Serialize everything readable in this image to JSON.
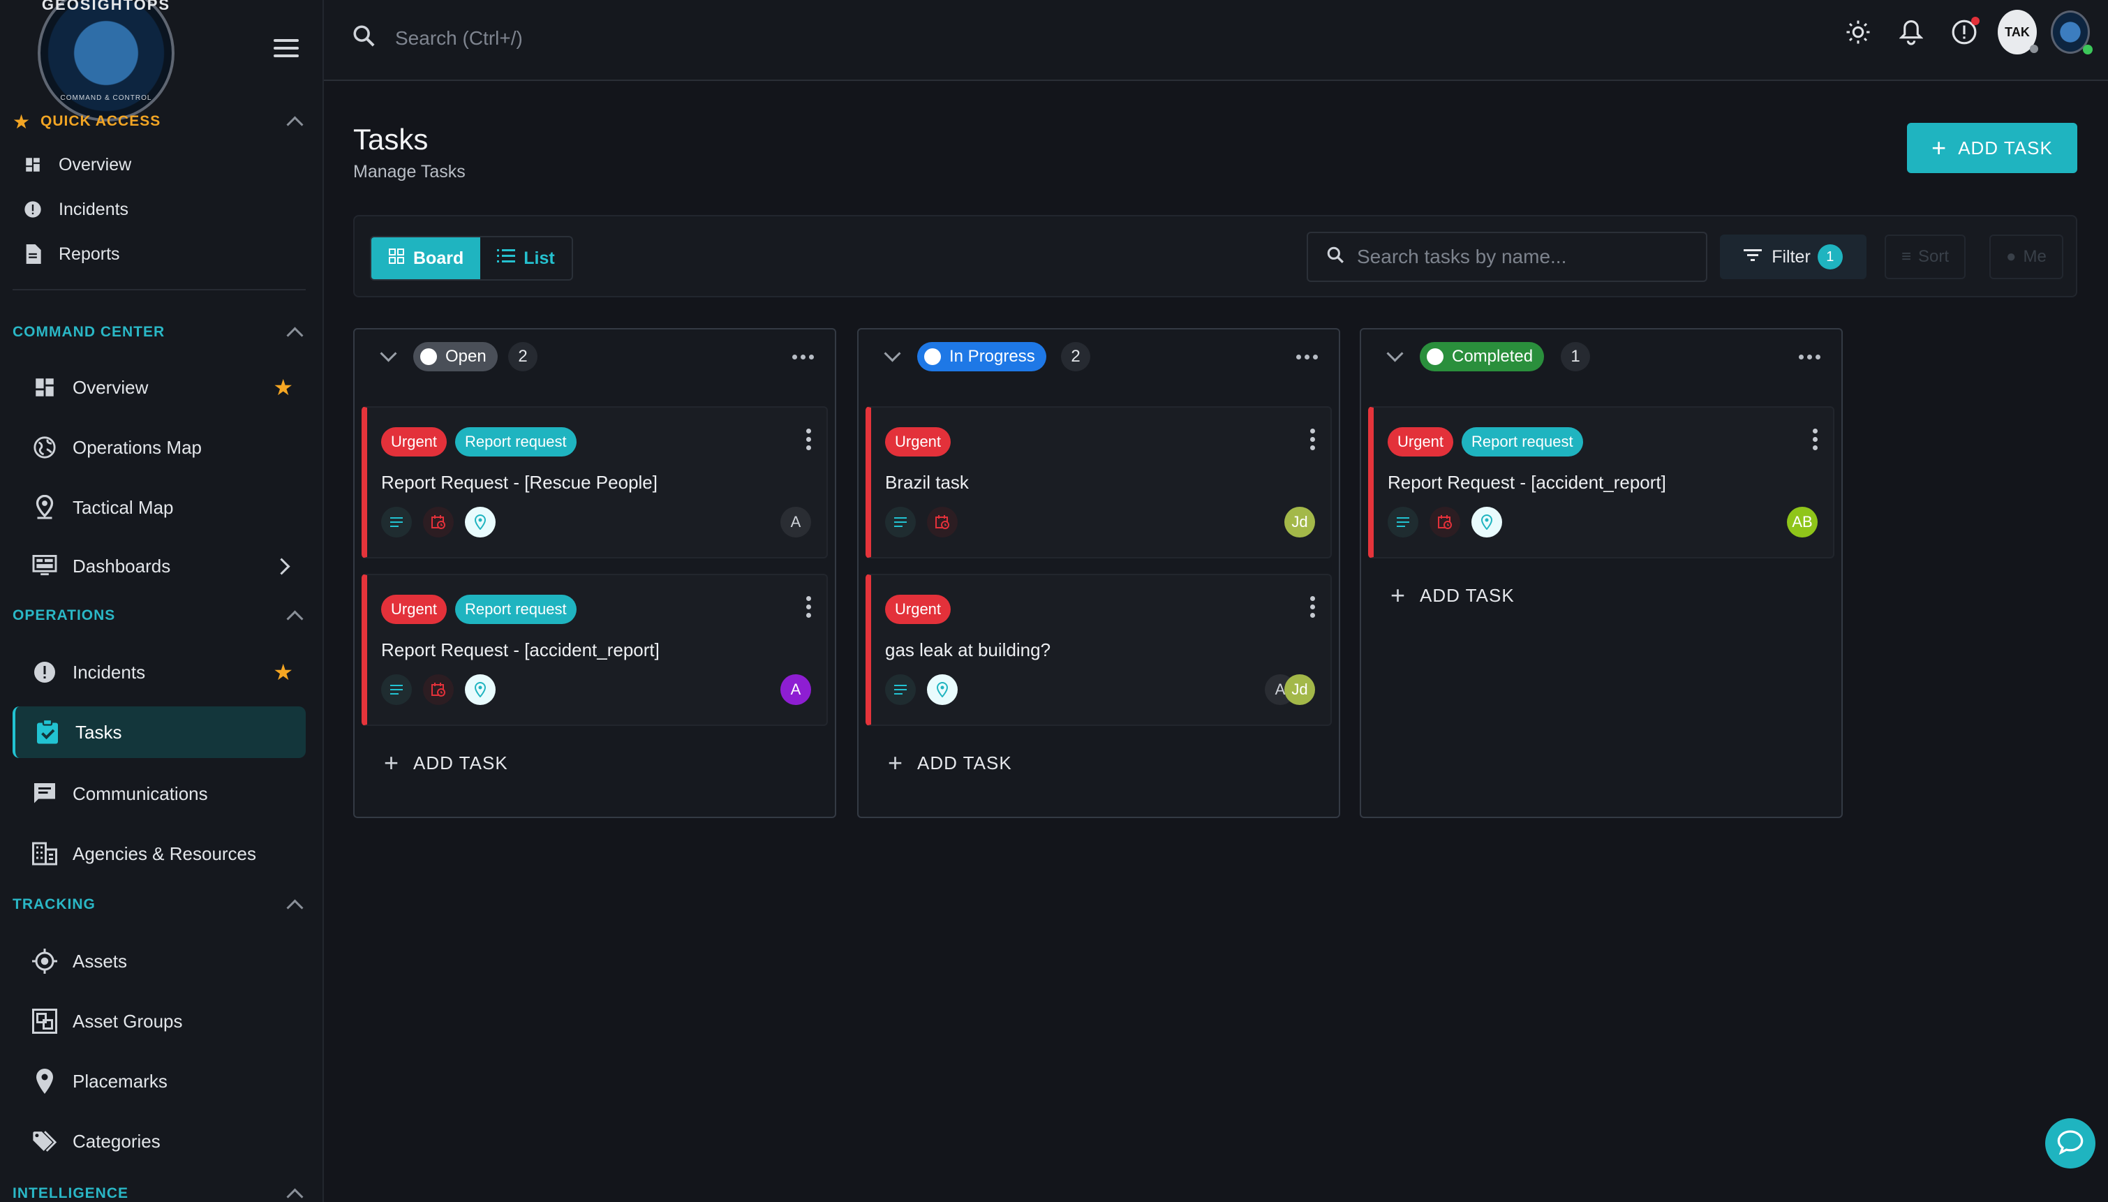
{
  "brand": {
    "logo_text": "GEOSIGHTOPS",
    "logo_sub": "COMMAND & CONTROL"
  },
  "sidebar": {
    "quick_access": {
      "title": "QUICK ACCESS",
      "items": [
        {
          "label": "Overview"
        },
        {
          "label": "Incidents"
        },
        {
          "label": "Reports"
        }
      ]
    },
    "command_center": {
      "title": "COMMAND CENTER",
      "items": [
        {
          "label": "Overview",
          "starred": true
        },
        {
          "label": "Operations Map"
        },
        {
          "label": "Tactical Map"
        },
        {
          "label": "Dashboards"
        }
      ]
    },
    "operations": {
      "title": "OPERATIONS",
      "items": [
        {
          "label": "Incidents",
          "starred": true
        },
        {
          "label": "Tasks",
          "active": true
        },
        {
          "label": "Communications"
        },
        {
          "label": "Agencies & Resources"
        }
      ]
    },
    "tracking": {
      "title": "TRACKING",
      "items": [
        {
          "label": "Assets"
        },
        {
          "label": "Asset Groups"
        },
        {
          "label": "Placemarks"
        },
        {
          "label": "Categories"
        }
      ]
    },
    "intelligence": {
      "title": "INTELLIGENCE"
    }
  },
  "topbar": {
    "search_placeholder": "Search (Ctrl+/)",
    "tak_label": "TAK"
  },
  "page": {
    "title": "Tasks",
    "subtitle": "Manage Tasks",
    "add_task_label": "ADD TASK"
  },
  "toolbar": {
    "views": [
      {
        "label": "Board",
        "active": true
      },
      {
        "label": "List"
      }
    ],
    "search_placeholder": "Search tasks by name...",
    "filter": {
      "label": "Filter",
      "count": "1"
    },
    "sort_label": "Sort",
    "me_label": "Me"
  },
  "columns": [
    {
      "status": "Open",
      "count": "2",
      "color": "#4a4f58",
      "add_label": "ADD TASK",
      "cards": [
        {
          "tags": [
            "Urgent",
            "Report request"
          ],
          "title": "Report Request - [Rescue People]",
          "avatars": [
            {
              "initial": "A",
              "color": "#2a2d33"
            }
          ]
        },
        {
          "tags": [
            "Urgent",
            "Report request"
          ],
          "title": "Report Request - [accident_report]",
          "avatars": [
            {
              "initial": "A",
              "color": "#8e1ed2"
            }
          ]
        }
      ]
    },
    {
      "status": "In Progress",
      "count": "2",
      "color": "#1e78e6",
      "add_label": "ADD TASK",
      "cards": [
        {
          "tags": [
            "Urgent"
          ],
          "title": "Brazil task",
          "avatars": [
            {
              "initial": "Jd",
              "color": "#a3b849"
            }
          ]
        },
        {
          "tags": [
            "Urgent"
          ],
          "title": "gas leak at building?",
          "avatars": [
            {
              "initial": "A",
              "color": "#2a2d33"
            },
            {
              "initial": "Jd",
              "color": "#a3b849"
            }
          ]
        }
      ]
    },
    {
      "status": "Completed",
      "count": "1",
      "color": "#2a8f3c",
      "add_label": "ADD TASK",
      "cards": [
        {
          "tags": [
            "Urgent",
            "Report request"
          ],
          "title": "Report Request - [accident_report]",
          "avatars": [
            {
              "initial": "AB",
              "color": "#8fc51a"
            }
          ]
        }
      ]
    }
  ],
  "colors": {
    "accent": "#1fb4c0",
    "urgent": "#e3313a",
    "quick_access": "#f2a524",
    "section": "#2ab7c6"
  }
}
